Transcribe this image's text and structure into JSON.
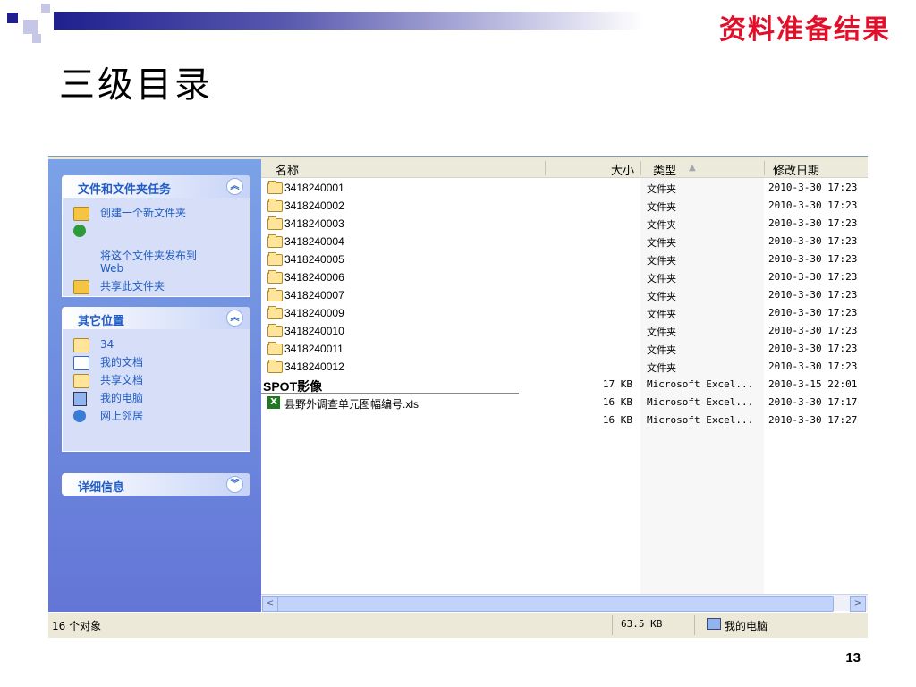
{
  "slide": {
    "corner_title": "资料准备结果",
    "title": "三级目录",
    "page_number": "13"
  },
  "taskpane": {
    "file_tasks": {
      "title": "文件和文件夹任务",
      "items": [
        "创建一个新文件夹",
        "将这个文件夹发布到\nWeb",
        "共享此文件夹"
      ]
    },
    "other_places": {
      "title": "其它位置",
      "items": [
        "34",
        "我的文档",
        "共享文档",
        "我的电脑",
        "网上邻居"
      ]
    },
    "details": {
      "title": "详细信息"
    }
  },
  "columns": {
    "name": "名称",
    "size": "大小",
    "type": "类型",
    "sort_indicator": "▲",
    "modified": "修改日期"
  },
  "rows": [
    {
      "name": "3418240001",
      "size": "",
      "type": "文件夹",
      "date": "2010-3-30 17:23",
      "icon": "folder-icon"
    },
    {
      "name": "3418240002",
      "size": "",
      "type": "文件夹",
      "date": "2010-3-30 17:23",
      "icon": "folder-icon"
    },
    {
      "name": "3418240003",
      "size": "",
      "type": "文件夹",
      "date": "2010-3-30 17:23",
      "icon": "folder-icon"
    },
    {
      "name": "3418240004",
      "size": "",
      "type": "文件夹",
      "date": "2010-3-30 17:23",
      "icon": "folder-icon"
    },
    {
      "name": "3418240005",
      "size": "",
      "type": "文件夹",
      "date": "2010-3-30 17:23",
      "icon": "folder-icon"
    },
    {
      "name": "3418240006",
      "size": "",
      "type": "文件夹",
      "date": "2010-3-30 17:23",
      "icon": "folder-icon"
    },
    {
      "name": "3418240007",
      "size": "",
      "type": "文件夹",
      "date": "2010-3-30 17:23",
      "icon": "folder-icon"
    },
    {
      "name": "3418240009",
      "size": "",
      "type": "文件夹",
      "date": "2010-3-30 17:23",
      "icon": "folder-icon"
    },
    {
      "name": "3418240010",
      "size": "",
      "type": "文件夹",
      "date": "2010-3-30 17:23",
      "icon": "folder-icon"
    },
    {
      "name": "3418240011",
      "size": "",
      "type": "文件夹",
      "date": "2010-3-30 17:23",
      "icon": "folder-icon"
    },
    {
      "name": "3418240012",
      "size": "",
      "type": "文件夹",
      "date": "2010-3-30 17:23",
      "icon": "folder-icon"
    },
    {
      "name": "SPOT影像",
      "size": "17 KB",
      "type": "Microsoft Excel...",
      "date": "2010-3-15 22:01",
      "icon": "none"
    },
    {
      "name": "县野外调查单元图幅编号.xls",
      "size": "16 KB",
      "type": "Microsoft Excel...",
      "date": "2010-3-30 17:17",
      "icon": "excel-icon"
    },
    {
      "name": "",
      "size": "16 KB",
      "type": "Microsoft Excel...",
      "date": "2010-3-30 17:27",
      "icon": "none"
    }
  ],
  "statusbar": {
    "object_count": "16 个对象",
    "total_size": "63.5 KB",
    "location": "我的电脑"
  },
  "colors": {
    "corner_title": "#e0102a",
    "taskpane_link": "#215dc6"
  }
}
